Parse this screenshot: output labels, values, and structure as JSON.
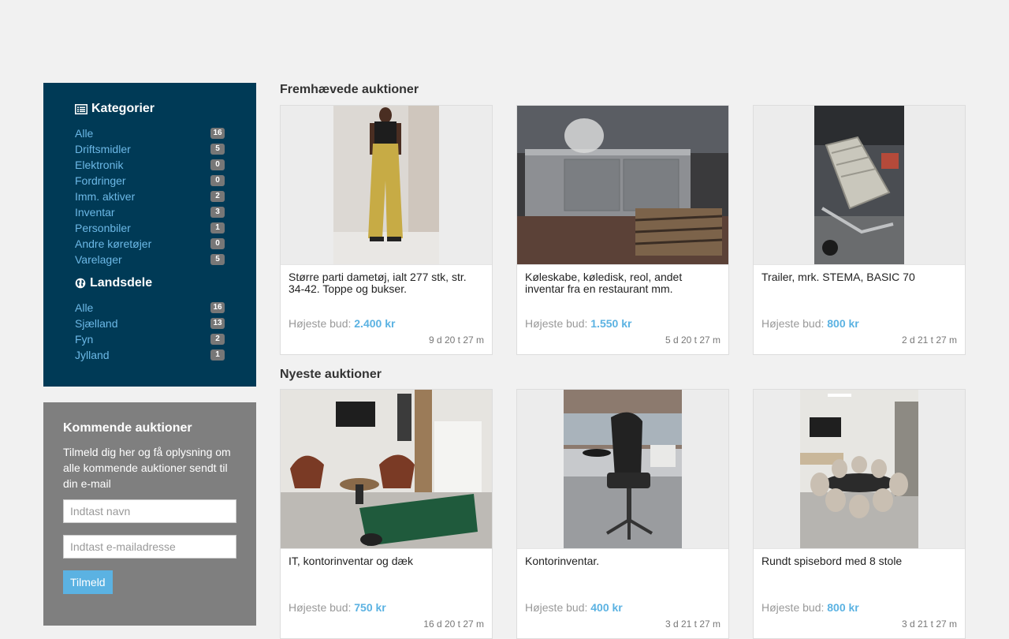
{
  "categories": {
    "heading": "Kategorier",
    "icon": "list-icon",
    "items": [
      {
        "label": "Alle",
        "count": "16"
      },
      {
        "label": "Driftsmidler",
        "count": "5"
      },
      {
        "label": "Elektronik",
        "count": "0"
      },
      {
        "label": "Fordringer",
        "count": "0"
      },
      {
        "label": "Imm. aktiver",
        "count": "2"
      },
      {
        "label": "Inventar",
        "count": "3"
      },
      {
        "label": "Personbiler",
        "count": "1"
      },
      {
        "label": "Andre køretøjer",
        "count": "0"
      },
      {
        "label": "Varelager",
        "count": "5"
      }
    ]
  },
  "regions": {
    "heading": "Landsdele",
    "icon": "globe-icon",
    "items": [
      {
        "label": "Alle",
        "count": "16"
      },
      {
        "label": "Sjælland",
        "count": "13"
      },
      {
        "label": "Fyn",
        "count": "2"
      },
      {
        "label": "Jylland",
        "count": "1"
      }
    ]
  },
  "signup": {
    "title": "Kommende auktioner",
    "text": "Tilmeld dig her og få oplysning om alle kommende auktioner sendt til din e-mail",
    "name_placeholder": "Indtast navn",
    "email_placeholder": "Indtast e-mailadresse",
    "button_label": "Tilmeld"
  },
  "featured": {
    "title": "Fremhævede auktioner",
    "cards": [
      {
        "title": "Større parti dametøj, ialt 277 stk, str. 34-42. Toppe og bukser.",
        "bid_label": "Højeste bud:",
        "bid_value": "2.400 kr",
        "timer": "9 d 20 t 27 m"
      },
      {
        "title": "Køleskabe, køledisk, reol, andet inventar fra en restaurant mm.",
        "bid_label": "Højeste bud:",
        "bid_value": "1.550 kr",
        "timer": "5 d 20 t 27 m"
      },
      {
        "title": "Trailer, mrk. STEMA, BASIC 70",
        "bid_label": "Højeste bud:",
        "bid_value": "800 kr",
        "timer": "2 d 21 t 27 m"
      }
    ]
  },
  "newest": {
    "title": "Nyeste auktioner",
    "cards": [
      {
        "title": "IT, kontorinventar og dæk",
        "bid_label": "Højeste bud:",
        "bid_value": "750 kr",
        "timer": "16 d 20 t 27 m"
      },
      {
        "title": "Kontorinventar.",
        "bid_label": "Højeste bud:",
        "bid_value": "400 kr",
        "timer": "3 d 21 t 27 m"
      },
      {
        "title": "Rundt spisebord med 8 stole",
        "bid_label": "Højeste bud:",
        "bid_value": "800 kr",
        "timer": "3 d 21 t 27 m"
      }
    ]
  },
  "colors": {
    "sidebar_bg": "#003a56",
    "link": "#6cb8e6",
    "accent": "#5bb2e2",
    "signup_bg": "#7f7f7f"
  }
}
